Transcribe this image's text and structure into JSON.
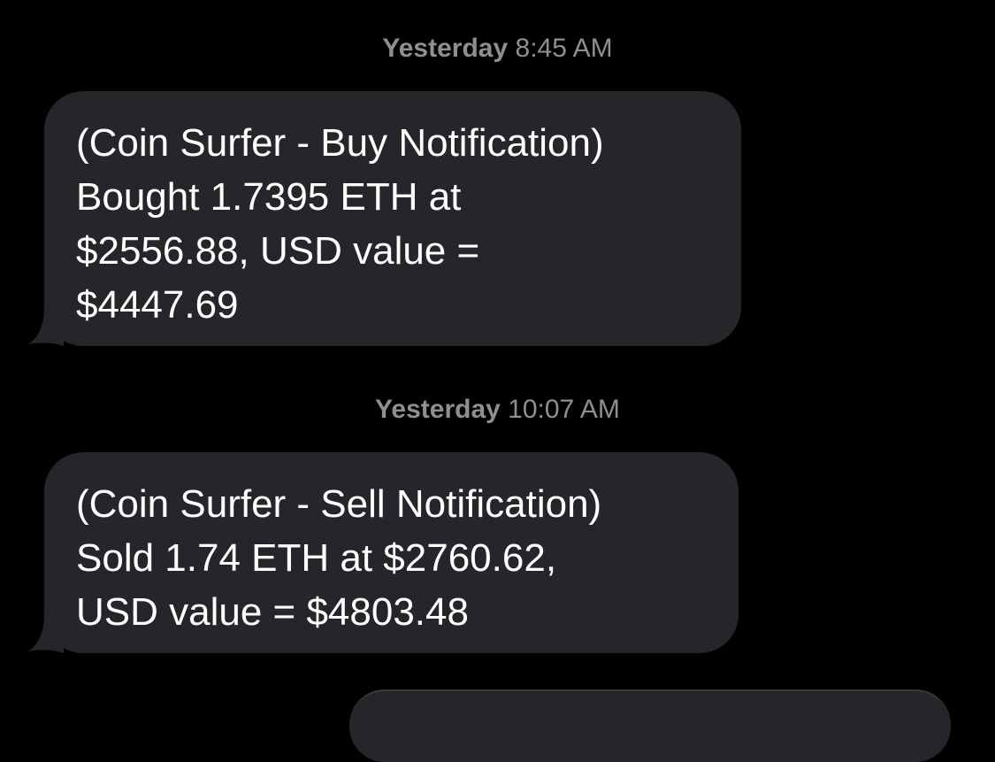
{
  "messages": [
    {
      "timestamp_day": "Yesterday",
      "timestamp_time": "8:45 AM",
      "lines": [
        "(Coin Surfer - Buy Notification)",
        "Bought 1.7395 ETH at",
        "$2556.88, USD value =",
        "$4447.69"
      ]
    },
    {
      "timestamp_day": "Yesterday",
      "timestamp_time": "10:07 AM",
      "lines": [
        "(Coin Surfer - Sell Notification)",
        "Sold 1.74 ETH at $2760.62,",
        "USD value = $4803.48"
      ]
    }
  ],
  "colors": {
    "background": "#000000",
    "bubble": "#26252a",
    "timestamp": "#8e8e93",
    "text": "#ffffff"
  }
}
